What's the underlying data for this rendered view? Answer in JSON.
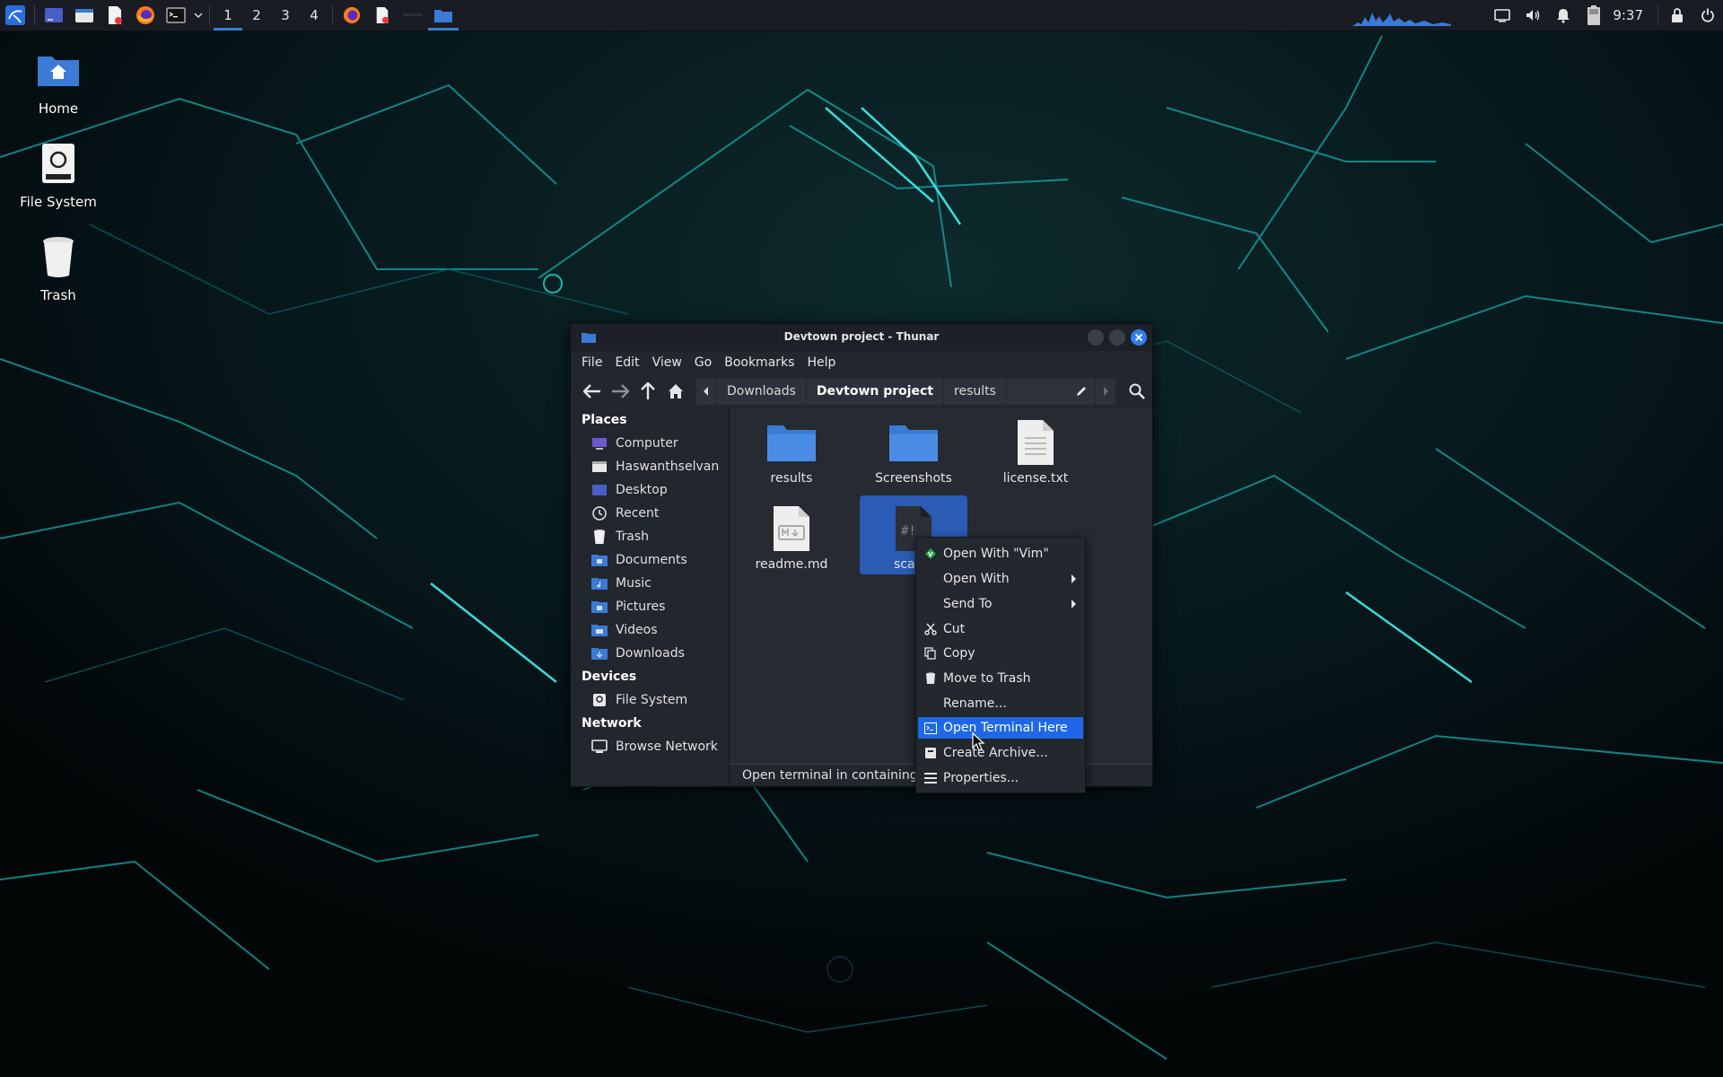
{
  "panel": {
    "workspaces": [
      "1",
      "2",
      "3",
      "4"
    ],
    "active_workspace": "1",
    "clock": "9:37",
    "launchers": [
      "kali-menu-icon",
      "show-desktop-icon",
      "file-manager-icon",
      "text-editor-icon",
      "firefox-icon",
      "terminal-icon"
    ],
    "tasks": [
      "firefox-task",
      "text-editor-task",
      "thunar-task"
    ],
    "tray": [
      "monitor-icon",
      "volume-icon",
      "bell-icon",
      "battery-icon",
      "lock-icon",
      "power-icon"
    ]
  },
  "desktop": {
    "icons": [
      {
        "label": "Home"
      },
      {
        "label": "File System"
      },
      {
        "label": "Trash"
      }
    ]
  },
  "window": {
    "title": "Devtown project - Thunar",
    "menu": [
      "File",
      "Edit",
      "View",
      "Go",
      "Bookmarks",
      "Help"
    ],
    "path": [
      "Downloads",
      "Devtown project",
      "results"
    ],
    "sidebar": {
      "places_heading": "Places",
      "places": [
        "Computer",
        "Haswanthselvan",
        "Desktop",
        "Recent",
        "Trash",
        "Documents",
        "Music",
        "Pictures",
        "Videos",
        "Downloads"
      ],
      "devices_heading": "Devices",
      "devices": [
        "File System"
      ],
      "network_heading": "Network",
      "network": [
        "Browse Network"
      ]
    },
    "files": [
      {
        "name": "results",
        "type": "folder"
      },
      {
        "name": "Screenshots",
        "type": "folder"
      },
      {
        "name": "license.txt",
        "type": "text"
      },
      {
        "name": "readme.md",
        "type": "markdown"
      },
      {
        "name": "scan",
        "type": "script",
        "selected": true
      }
    ],
    "status": "Open terminal in containing di"
  },
  "context_menu": {
    "items": [
      {
        "label": "Open With \"Vim\"",
        "icon": "vim-icon"
      },
      {
        "label": "Open With",
        "submenu": true
      },
      {
        "label": "Send To",
        "submenu": true
      },
      {
        "label": "Cut",
        "icon": "scissors-icon"
      },
      {
        "label": "Copy",
        "icon": "copy-icon"
      },
      {
        "label": "Move to Trash",
        "icon": "trash-icon"
      },
      {
        "label": "Rename..."
      },
      {
        "label": "Open Terminal Here",
        "icon": "terminal-icon",
        "highlighted": true
      },
      {
        "label": "Create Archive...",
        "icon": "archive-icon"
      },
      {
        "label": "Properties...",
        "icon": "properties-icon"
      }
    ]
  },
  "colors": {
    "accent": "#1e68e8",
    "panel": "#191c22",
    "window": "#22262d",
    "wallpaper_lines": "#19c6c6"
  }
}
